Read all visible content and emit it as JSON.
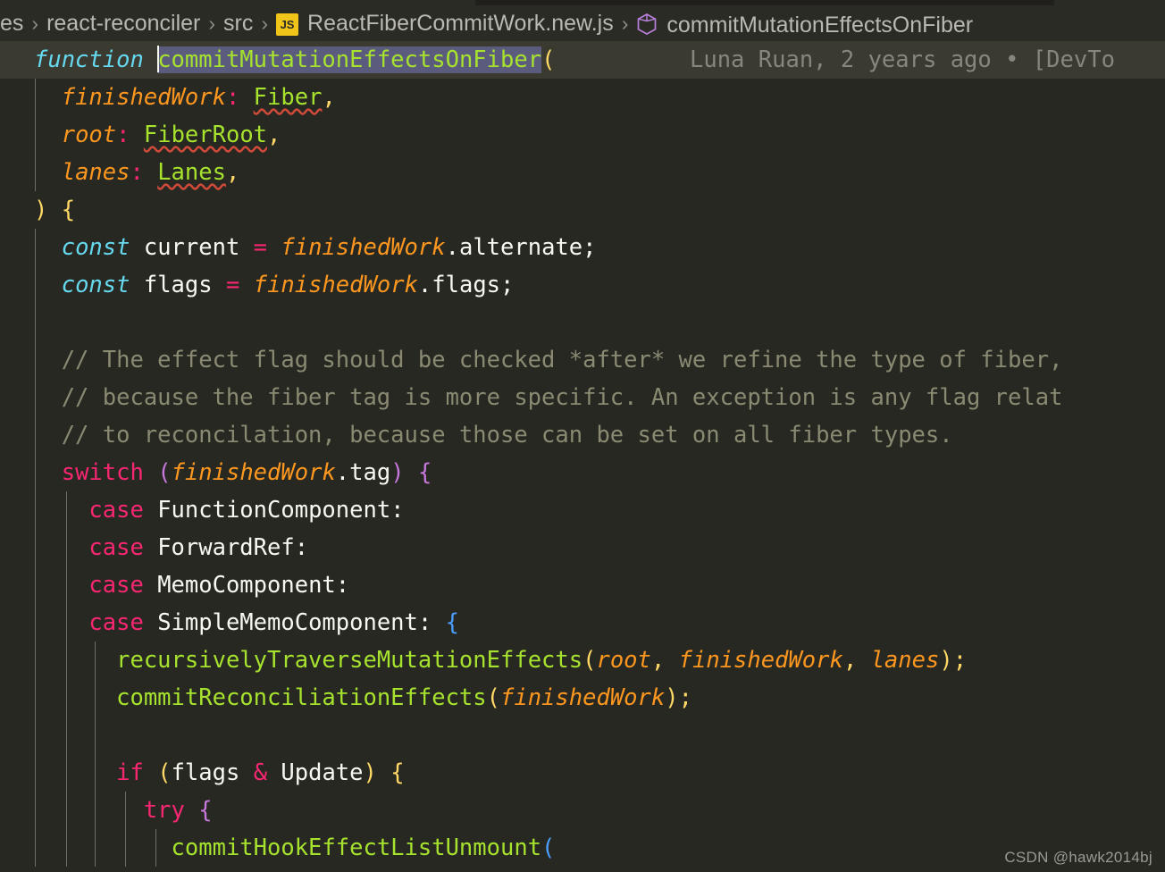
{
  "window": {
    "theme_background": "#272822",
    "accent_selection": "#5b5b7d"
  },
  "breadcrumb": {
    "segments": [
      {
        "label": "es",
        "icon": null
      },
      {
        "label": "react-reconciler",
        "icon": null
      },
      {
        "label": "src",
        "icon": null
      },
      {
        "label": "ReactFiberCommitWork.new.js",
        "icon": "js-file-icon",
        "icon_text": "JS"
      },
      {
        "label": "commitMutationEffectsOnFiber",
        "icon": "symbol-method-icon"
      }
    ],
    "separator": "›"
  },
  "blame": {
    "text": "Luna Ruan, 2 years ago • [DevTo"
  },
  "editor": {
    "selection_text": "commitMutationEffectsOnFiber",
    "cursor_visible": true,
    "code_lines": [
      {
        "n": 1,
        "indent_guides": [],
        "highlighted": true,
        "tokens": [
          {
            "t": "function",
            "c": "kw"
          },
          {
            "t": " ",
            "c": "plain"
          },
          {
            "t": "commitMutationEffectsOnFiber",
            "c": "fn sel"
          },
          {
            "t": "(",
            "c": "b-yellow"
          }
        ]
      },
      {
        "n": 2,
        "indent_guides": [
          39
        ],
        "tokens": [
          {
            "t": "  ",
            "c": "plain"
          },
          {
            "t": "finishedWork",
            "c": "param"
          },
          {
            "t": ":",
            "c": "punc"
          },
          {
            "t": " ",
            "c": "plain"
          },
          {
            "t": "Fiber",
            "c": "type squiggle"
          },
          {
            "t": ",",
            "c": "b-yellow"
          }
        ]
      },
      {
        "n": 3,
        "indent_guides": [
          39
        ],
        "tokens": [
          {
            "t": "  ",
            "c": "plain"
          },
          {
            "t": "root",
            "c": "param"
          },
          {
            "t": ":",
            "c": "punc"
          },
          {
            "t": " ",
            "c": "plain"
          },
          {
            "t": "FiberRoot",
            "c": "type squiggle"
          },
          {
            "t": ",",
            "c": "b-yellow"
          }
        ]
      },
      {
        "n": 4,
        "indent_guides": [
          39
        ],
        "tokens": [
          {
            "t": "  ",
            "c": "plain"
          },
          {
            "t": "lanes",
            "c": "param"
          },
          {
            "t": ":",
            "c": "punc"
          },
          {
            "t": " ",
            "c": "plain"
          },
          {
            "t": "Lanes",
            "c": "type squiggle"
          },
          {
            "t": ",",
            "c": "b-yellow"
          }
        ]
      },
      {
        "n": 5,
        "indent_guides": [],
        "tokens": [
          {
            "t": ")",
            "c": "b-yellow"
          },
          {
            "t": " ",
            "c": "plain"
          },
          {
            "t": "{",
            "c": "b-yellow"
          }
        ]
      },
      {
        "n": 6,
        "indent_guides": [
          39
        ],
        "tokens": [
          {
            "t": "  ",
            "c": "plain"
          },
          {
            "t": "const",
            "c": "kw"
          },
          {
            "t": " current ",
            "c": "plain"
          },
          {
            "t": "=",
            "c": "punc"
          },
          {
            "t": " ",
            "c": "plain"
          },
          {
            "t": "finishedWork",
            "c": "param"
          },
          {
            "t": ".alternate;",
            "c": "plain"
          }
        ]
      },
      {
        "n": 7,
        "indent_guides": [
          39
        ],
        "tokens": [
          {
            "t": "  ",
            "c": "plain"
          },
          {
            "t": "const",
            "c": "kw"
          },
          {
            "t": " flags ",
            "c": "plain"
          },
          {
            "t": "=",
            "c": "punc"
          },
          {
            "t": " ",
            "c": "plain"
          },
          {
            "t": "finishedWork",
            "c": "param"
          },
          {
            "t": ".flags;",
            "c": "plain"
          }
        ]
      },
      {
        "n": 8,
        "indent_guides": [
          39
        ],
        "tokens": []
      },
      {
        "n": 9,
        "indent_guides": [
          39
        ],
        "tokens": [
          {
            "t": "  // The effect flag should be checked *after* we refine the type of fiber,",
            "c": "comment"
          }
        ]
      },
      {
        "n": 10,
        "indent_guides": [
          39
        ],
        "tokens": [
          {
            "t": "  // because the fiber tag is more specific. An exception is any flag relat",
            "c": "comment"
          }
        ]
      },
      {
        "n": 11,
        "indent_guides": [
          39
        ],
        "tokens": [
          {
            "t": "  // to reconcilation, because those can be set on all fiber types.",
            "c": "comment"
          }
        ]
      },
      {
        "n": 12,
        "indent_guides": [
          39
        ],
        "tokens": [
          {
            "t": "  ",
            "c": "plain"
          },
          {
            "t": "switch",
            "c": "kw2"
          },
          {
            "t": " ",
            "c": "plain"
          },
          {
            "t": "(",
            "c": "b-purple"
          },
          {
            "t": "finishedWork",
            "c": "param"
          },
          {
            "t": ".tag",
            "c": "plain"
          },
          {
            "t": ")",
            "c": "b-purple"
          },
          {
            "t": " ",
            "c": "plain"
          },
          {
            "t": "{",
            "c": "b-purple"
          }
        ]
      },
      {
        "n": 13,
        "indent_guides": [
          39,
          74
        ],
        "tokens": [
          {
            "t": "    ",
            "c": "plain"
          },
          {
            "t": "case",
            "c": "kw2"
          },
          {
            "t": " FunctionComponent:",
            "c": "plain"
          }
        ]
      },
      {
        "n": 14,
        "indent_guides": [
          39,
          74
        ],
        "tokens": [
          {
            "t": "    ",
            "c": "plain"
          },
          {
            "t": "case",
            "c": "kw2"
          },
          {
            "t": " ForwardRef:",
            "c": "plain"
          }
        ]
      },
      {
        "n": 15,
        "indent_guides": [
          39,
          74
        ],
        "tokens": [
          {
            "t": "    ",
            "c": "plain"
          },
          {
            "t": "case",
            "c": "kw2"
          },
          {
            "t": " MemoComponent:",
            "c": "plain"
          }
        ]
      },
      {
        "n": 16,
        "indent_guides": [
          39,
          74
        ],
        "tokens": [
          {
            "t": "    ",
            "c": "plain"
          },
          {
            "t": "case",
            "c": "kw2"
          },
          {
            "t": " SimpleMemoComponent: ",
            "c": "plain"
          },
          {
            "t": "{",
            "c": "b-blue"
          }
        ]
      },
      {
        "n": 17,
        "indent_guides": [
          39,
          74,
          106
        ],
        "tokens": [
          {
            "t": "      ",
            "c": "plain"
          },
          {
            "t": "recursivelyTraverseMutationEffects",
            "c": "fn"
          },
          {
            "t": "(",
            "c": "b-yellow"
          },
          {
            "t": "root",
            "c": "param"
          },
          {
            "t": ",",
            "c": "b-yellow"
          },
          {
            "t": " ",
            "c": "plain"
          },
          {
            "t": "finishedWork",
            "c": "param"
          },
          {
            "t": ",",
            "c": "b-yellow"
          },
          {
            "t": " ",
            "c": "plain"
          },
          {
            "t": "lanes",
            "c": "param"
          },
          {
            "t": ")",
            "c": "b-yellow"
          },
          {
            "t": ";",
            "c": "b-yellow"
          }
        ]
      },
      {
        "n": 18,
        "indent_guides": [
          39,
          74,
          106
        ],
        "tokens": [
          {
            "t": "      ",
            "c": "plain"
          },
          {
            "t": "commitReconciliationEffects",
            "c": "fn"
          },
          {
            "t": "(",
            "c": "b-yellow"
          },
          {
            "t": "finishedWork",
            "c": "param"
          },
          {
            "t": ")",
            "c": "b-yellow"
          },
          {
            "t": ";",
            "c": "b-yellow"
          }
        ]
      },
      {
        "n": 19,
        "indent_guides": [
          39,
          74,
          106
        ],
        "tokens": []
      },
      {
        "n": 20,
        "indent_guides": [
          39,
          74,
          106
        ],
        "tokens": [
          {
            "t": "      ",
            "c": "plain"
          },
          {
            "t": "if",
            "c": "kw2"
          },
          {
            "t": " ",
            "c": "plain"
          },
          {
            "t": "(",
            "c": "b-yellow"
          },
          {
            "t": "flags ",
            "c": "plain"
          },
          {
            "t": "&",
            "c": "punc"
          },
          {
            "t": " Update",
            "c": "plain"
          },
          {
            "t": ")",
            "c": "b-yellow"
          },
          {
            "t": " ",
            "c": "plain"
          },
          {
            "t": "{",
            "c": "b-yellow"
          }
        ]
      },
      {
        "n": 21,
        "indent_guides": [
          39,
          74,
          106,
          140
        ],
        "tokens": [
          {
            "t": "        ",
            "c": "plain"
          },
          {
            "t": "try",
            "c": "kw2"
          },
          {
            "t": " ",
            "c": "plain"
          },
          {
            "t": "{",
            "c": "b-purple"
          }
        ]
      },
      {
        "n": 22,
        "indent_guides": [
          39,
          74,
          106,
          140,
          174
        ],
        "tokens": [
          {
            "t": "          ",
            "c": "plain"
          },
          {
            "t": "commitHookEffectListUnmount",
            "c": "fn"
          },
          {
            "t": "(",
            "c": "b-blue"
          }
        ]
      }
    ]
  },
  "watermark": {
    "text": "CSDN @hawk2014bj"
  }
}
